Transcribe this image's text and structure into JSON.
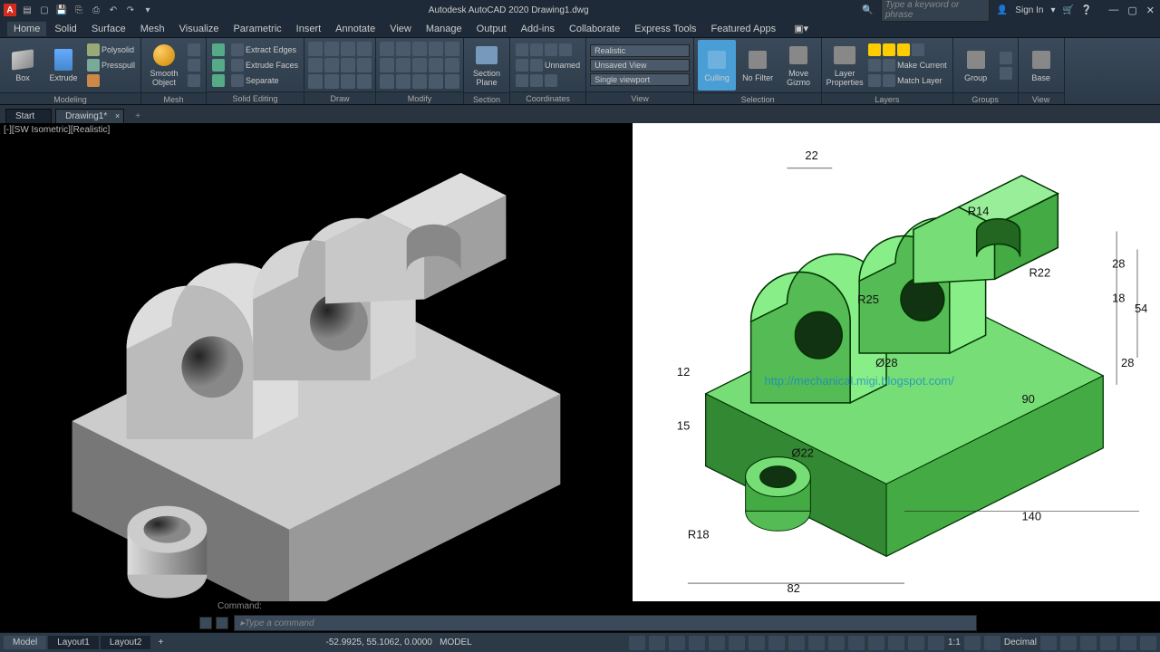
{
  "app": {
    "title": "Autodesk AutoCAD 2020   Drawing1.dwg",
    "search_placeholder": "Type a keyword or phrase",
    "signin": "Sign In"
  },
  "menus": [
    "Home",
    "Solid",
    "Surface",
    "Mesh",
    "Visualize",
    "Parametric",
    "Insert",
    "Annotate",
    "View",
    "Manage",
    "Output",
    "Add-ins",
    "Collaborate",
    "Express Tools",
    "Featured Apps"
  ],
  "ribbon": {
    "modeling": {
      "box": "Box",
      "extrude": "Extrude",
      "polysolid": "Polysolid",
      "presspull": "Presspull",
      "title": "Modeling"
    },
    "mesh": {
      "smooth": "Smooth\nObject",
      "title": "Mesh"
    },
    "solidedit": {
      "eedges": "Extract Edges",
      "efaces": "Extrude Faces",
      "sep": "Separate",
      "title": "Solid Editing"
    },
    "draw": "Draw",
    "modify": "Modify",
    "section": {
      "section": "Section\nPlane",
      "title": "Section"
    },
    "coords": {
      "unnamed": "Unnamed",
      "title": "Coordinates"
    },
    "view": {
      "style": "Realistic",
      "unsaved": "Unsaved View",
      "viewport": "Single viewport",
      "title": "View",
      "title2": "View"
    },
    "selection": {
      "culling": "Culling",
      "nofilter": "No Filter",
      "gizmo": "Move\nGizmo",
      "title": "Selection"
    },
    "layers": {
      "props": "Layer\nProperties",
      "make": "Make Current",
      "match": "Match Layer",
      "title": "Layers"
    },
    "groups": {
      "group": "Group",
      "title": "Groups"
    },
    "base": {
      "base": "Base",
      "title": "View"
    }
  },
  "tabs": {
    "start": "Start",
    "drawing": "Drawing1*"
  },
  "viewport_label": "[-][SW Isometric][Realistic]",
  "ref": {
    "watermark": "http://mechanical.migi.blogspot.com/",
    "dims": {
      "d22": "22",
      "d12": "12",
      "d15": "15",
      "r18": "R18",
      "d82": "82",
      "phi22": "Ø22",
      "phi28": "Ø28",
      "r25": "R25",
      "r14": "R14",
      "r22": "R22",
      "d28": "28",
      "d18": "18",
      "d54": "54",
      "d28b": "28",
      "d90": "90",
      "d140": "140"
    }
  },
  "cmd": {
    "label": "Command:",
    "placeholder": "Type a command"
  },
  "status": {
    "tabs": [
      "Model",
      "Layout1",
      "Layout2"
    ],
    "coords": "-52.9925, 55.1062, 0.0000",
    "model": "MODEL",
    "scale": "1:1",
    "units": "Decimal"
  }
}
